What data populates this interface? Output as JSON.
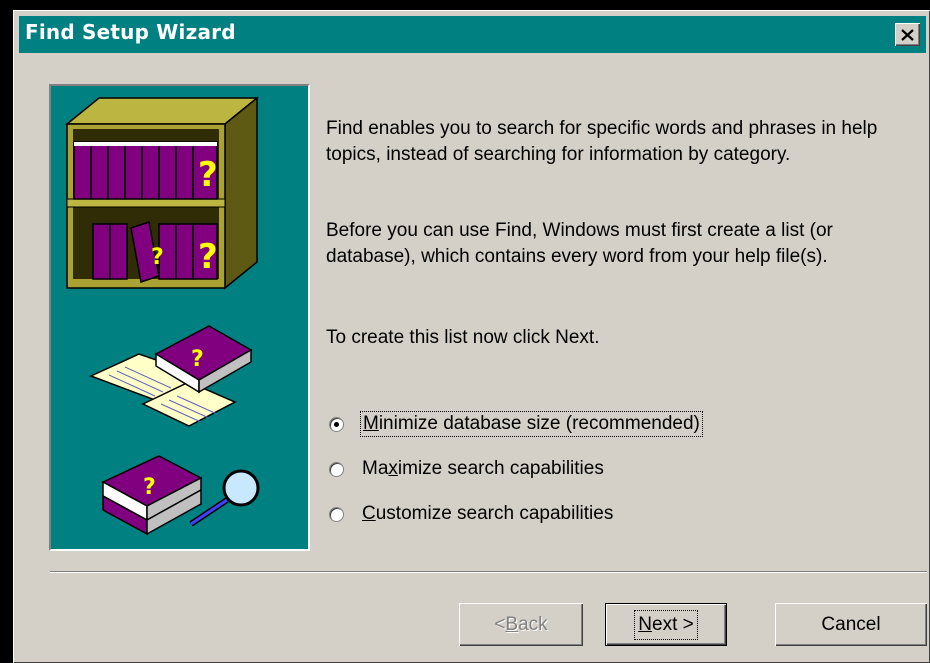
{
  "window": {
    "title": "Find Setup Wizard",
    "close_glyph": "×"
  },
  "content": {
    "paragraph1": "Find enables you to search for specific words and phrases in help topics, instead of searching for information by category.",
    "paragraph2": "Before you can use Find, Windows must first create a list (or database), which contains every word from your help file(s).",
    "paragraph3": "To create this list now click Next."
  },
  "options": [
    {
      "pre": "",
      "accel": "M",
      "post": "inimize database size (recommended)",
      "selected": true
    },
    {
      "pre": "Ma",
      "accel": "x",
      "post": "imize search capabilities",
      "selected": false
    },
    {
      "pre": "",
      "accel": "C",
      "post": "ustomize search capabilities",
      "selected": false
    }
  ],
  "buttons": {
    "back": {
      "pre": "< ",
      "accel": "B",
      "post": "ack",
      "enabled": false
    },
    "next": {
      "pre": "",
      "accel": "N",
      "post": "ext >"
    },
    "cancel": "Cancel"
  },
  "colors": {
    "titlebar": "#008080",
    "dialog_face": "#d4d0c8",
    "art_background": "#008080"
  },
  "icons": [
    "close-icon",
    "bookshelf-icon",
    "open-book-icon",
    "search-book-icon",
    "magnifier-icon"
  ]
}
